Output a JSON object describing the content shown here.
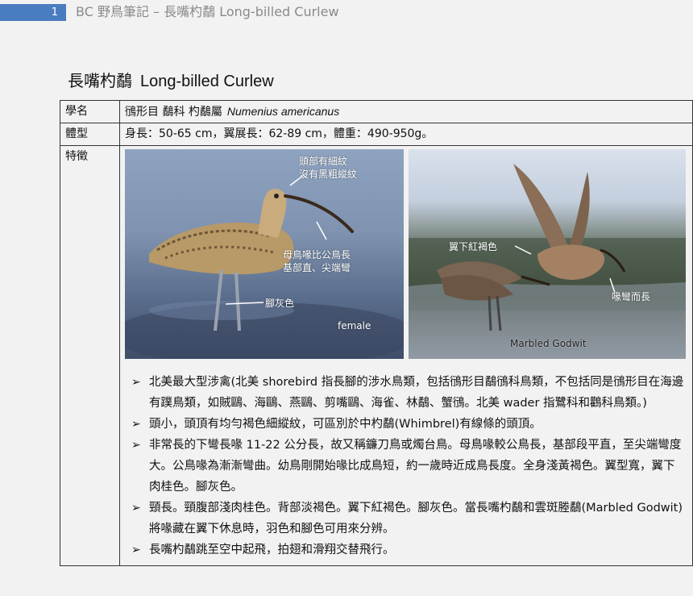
{
  "header": {
    "page_number": "1",
    "title": "BC 野鳥筆記 – 長嘴杓鷸 Long-billed Curlew"
  },
  "doc": {
    "title_zh": "長嘴杓鷸",
    "title_en": "Long-billed Curlew"
  },
  "table": {
    "rows": [
      {
        "label": "學名",
        "value": "鴴形目 鷸科 杓鷸屬",
        "scientific_name": "Numenius americanus"
      },
      {
        "label": "體型",
        "value": "身長：50-65 cm，翼展長：62-89 cm，體重：490-950g。"
      },
      {
        "label": "特徵"
      }
    ]
  },
  "photos": {
    "left": {
      "caption_head_1": "頭部有細紋",
      "caption_head_2": "沒有黑粗縱紋",
      "caption_bill_1": "母鳥喙比公鳥長",
      "caption_bill_2": "基部直、尖端彎",
      "caption_legs": "腳灰色",
      "caption_sex": "female"
    },
    "right": {
      "caption_wing": "翼下紅褐色",
      "caption_bill": "喙彎而長",
      "caption_other": "Marbled Godwit"
    }
  },
  "features": [
    "北美最大型涉禽(北美 shorebird 指長腳的涉水鳥類，包括鴴形目鷸鴴科鳥類，不包括同是鴴形目在海邊有蹼鳥類，如賊鷗、海鷗、燕鷗、剪嘴鷗、海雀、林鷸、蟹鴴。北美 wader 指鷺科和鸛科鳥類。)",
    "頭小，頭頂有均勻褐色細縱紋，可區別於中杓鷸(Whimbrel)有線條的頭頂。",
    "非常長的下彎長喙 11-22 公分長，故又稱鐮刀鳥或燭台鳥。母鳥喙較公鳥長，基部段平直，至尖端彎度大。公鳥喙為漸漸彎曲。幼鳥剛開始喙比成鳥短，約一歲時近成鳥長度。全身淺黃褐色。翼型寬，翼下肉桂色。腳灰色。",
    "頸長。頸腹部淺肉桂色。背部淡褐色。翼下紅褐色。腳灰色。當長嘴杓鷸和雲斑塍鷸(Marbled Godwit)將喙藏在翼下休息時，羽色和腳色可用來分辨。",
    "長嘴杓鷸跳至空中起飛，拍翅和滑翔交替飛行。"
  ]
}
